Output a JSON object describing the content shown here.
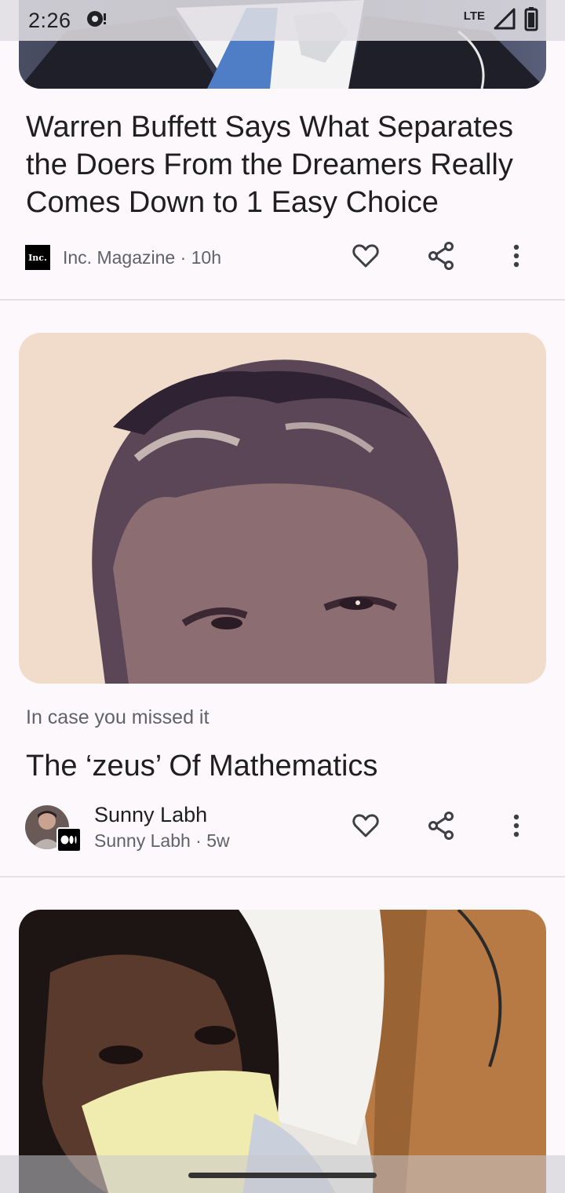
{
  "status_bar": {
    "time": "2:26",
    "network": "LTE",
    "icons": [
      "notification-dot-icon",
      "signal-icon",
      "battery-icon"
    ]
  },
  "cards": [
    {
      "image": "man-in-suit-photo",
      "title": "Warren Buffett Says What Separates the Doers From the Dreamers Really Comes Down to 1 Easy Choice",
      "source_logo_text": "Inc.",
      "source": "Inc. Magazine · 10h"
    },
    {
      "image": "vintage-portrait-photo",
      "label": "In case you missed it",
      "title": "The ‘zeus’ Of Mathematics",
      "author": "Sunny Labh",
      "source": "Sunny Labh · 5w"
    },
    {
      "image": "woman-with-face-mask-photo"
    }
  ],
  "colors": {
    "background": "#fdf8fb",
    "text_primary": "#1f1f1f",
    "text_secondary": "#5f6368",
    "divider": "#e4e1e6"
  }
}
